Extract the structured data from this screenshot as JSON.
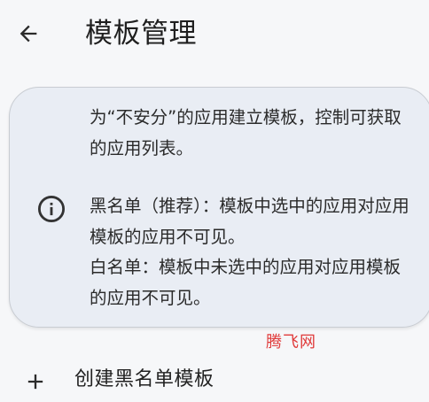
{
  "header": {
    "back_icon": "arrow-left-icon",
    "title": "模板管理"
  },
  "info_card": {
    "icon": "info-icon",
    "intro": "为“不安分”的应用建立模板，控制可获取的应用列表。",
    "blacklist_desc": "黑名单（推荐）：模板中选中的应用对应用模板的应用不可见。",
    "whitelist_desc": "白名单：模板中未选中的应用对应用模板的应用不可见。"
  },
  "watermark": "腾飞网",
  "actions": {
    "create_icon": "plus-icon",
    "create_blacklist_label": "创建黑名单模板"
  },
  "colors": {
    "background": "#f6f7f9",
    "card_background": "#e9edf4",
    "watermark": "#e03a3a"
  }
}
